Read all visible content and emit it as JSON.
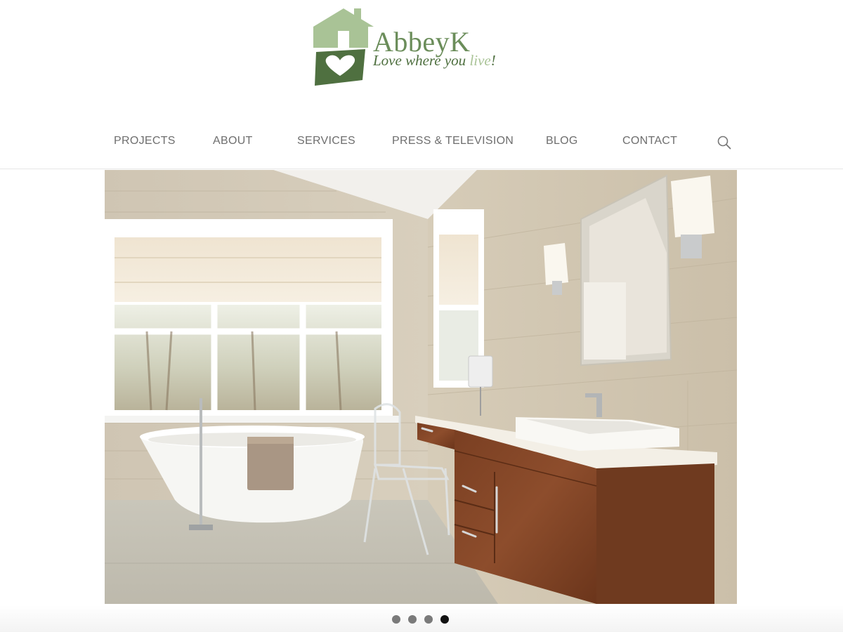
{
  "brand": {
    "name": "AbbeyK",
    "tagline_main": "Love where you ",
    "tagline_accent": "live",
    "tagline_end": "!",
    "colors": {
      "dark_green": "#4f7040",
      "light_green": "#a9c396",
      "mid_green": "#6b8d5a"
    }
  },
  "nav": {
    "items": [
      {
        "label": "PROJECTS"
      },
      {
        "label": "ABOUT"
      },
      {
        "label": "SERVICES"
      },
      {
        "label": "PRESS & TELEVISION"
      },
      {
        "label": "BLOG"
      },
      {
        "label": "CONTACT"
      }
    ],
    "search_icon": "search-icon"
  },
  "hero": {
    "image_subject": "bathroom-interior-photo",
    "slide_count": 4,
    "active_slide": 4
  }
}
